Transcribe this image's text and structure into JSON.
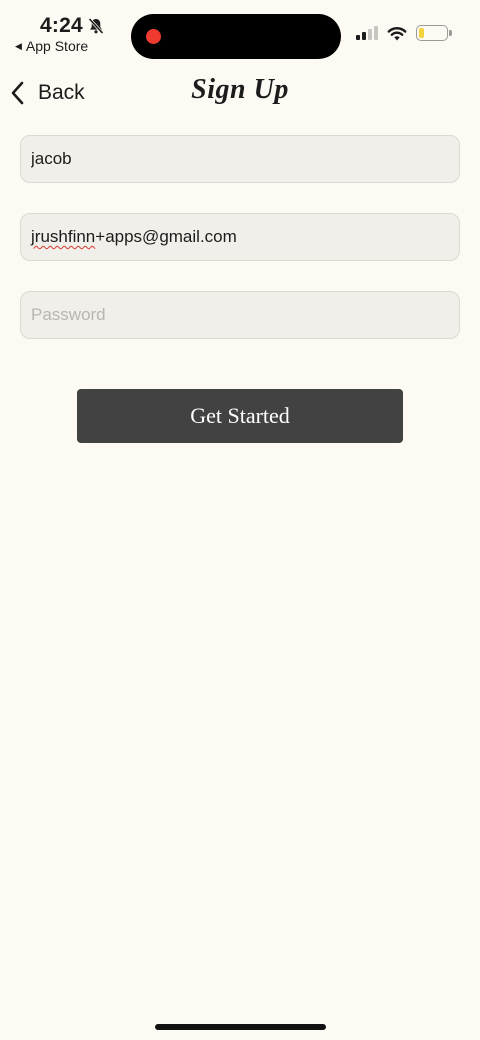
{
  "status_bar": {
    "time": "4:24",
    "back_to_app": "App Store",
    "icons": [
      "bell-slash-icon",
      "cellular-signal-icon",
      "wifi-icon",
      "battery-icon"
    ],
    "recording_color": "#ef3b2f",
    "battery_fill_fraction": 0.2
  },
  "nav": {
    "back_label": "Back",
    "title": "Sign Up"
  },
  "form": {
    "name_value": "jacob",
    "email_local_misspelled": "jrushfinn",
    "email_rest": "+apps@gmail.com",
    "password_value": "",
    "password_placeholder": "Password",
    "submit_label": "Get Started"
  },
  "colors": {
    "background": "#fdfaf4",
    "field_bg": "#f1efea",
    "button_bg": "#434242"
  }
}
